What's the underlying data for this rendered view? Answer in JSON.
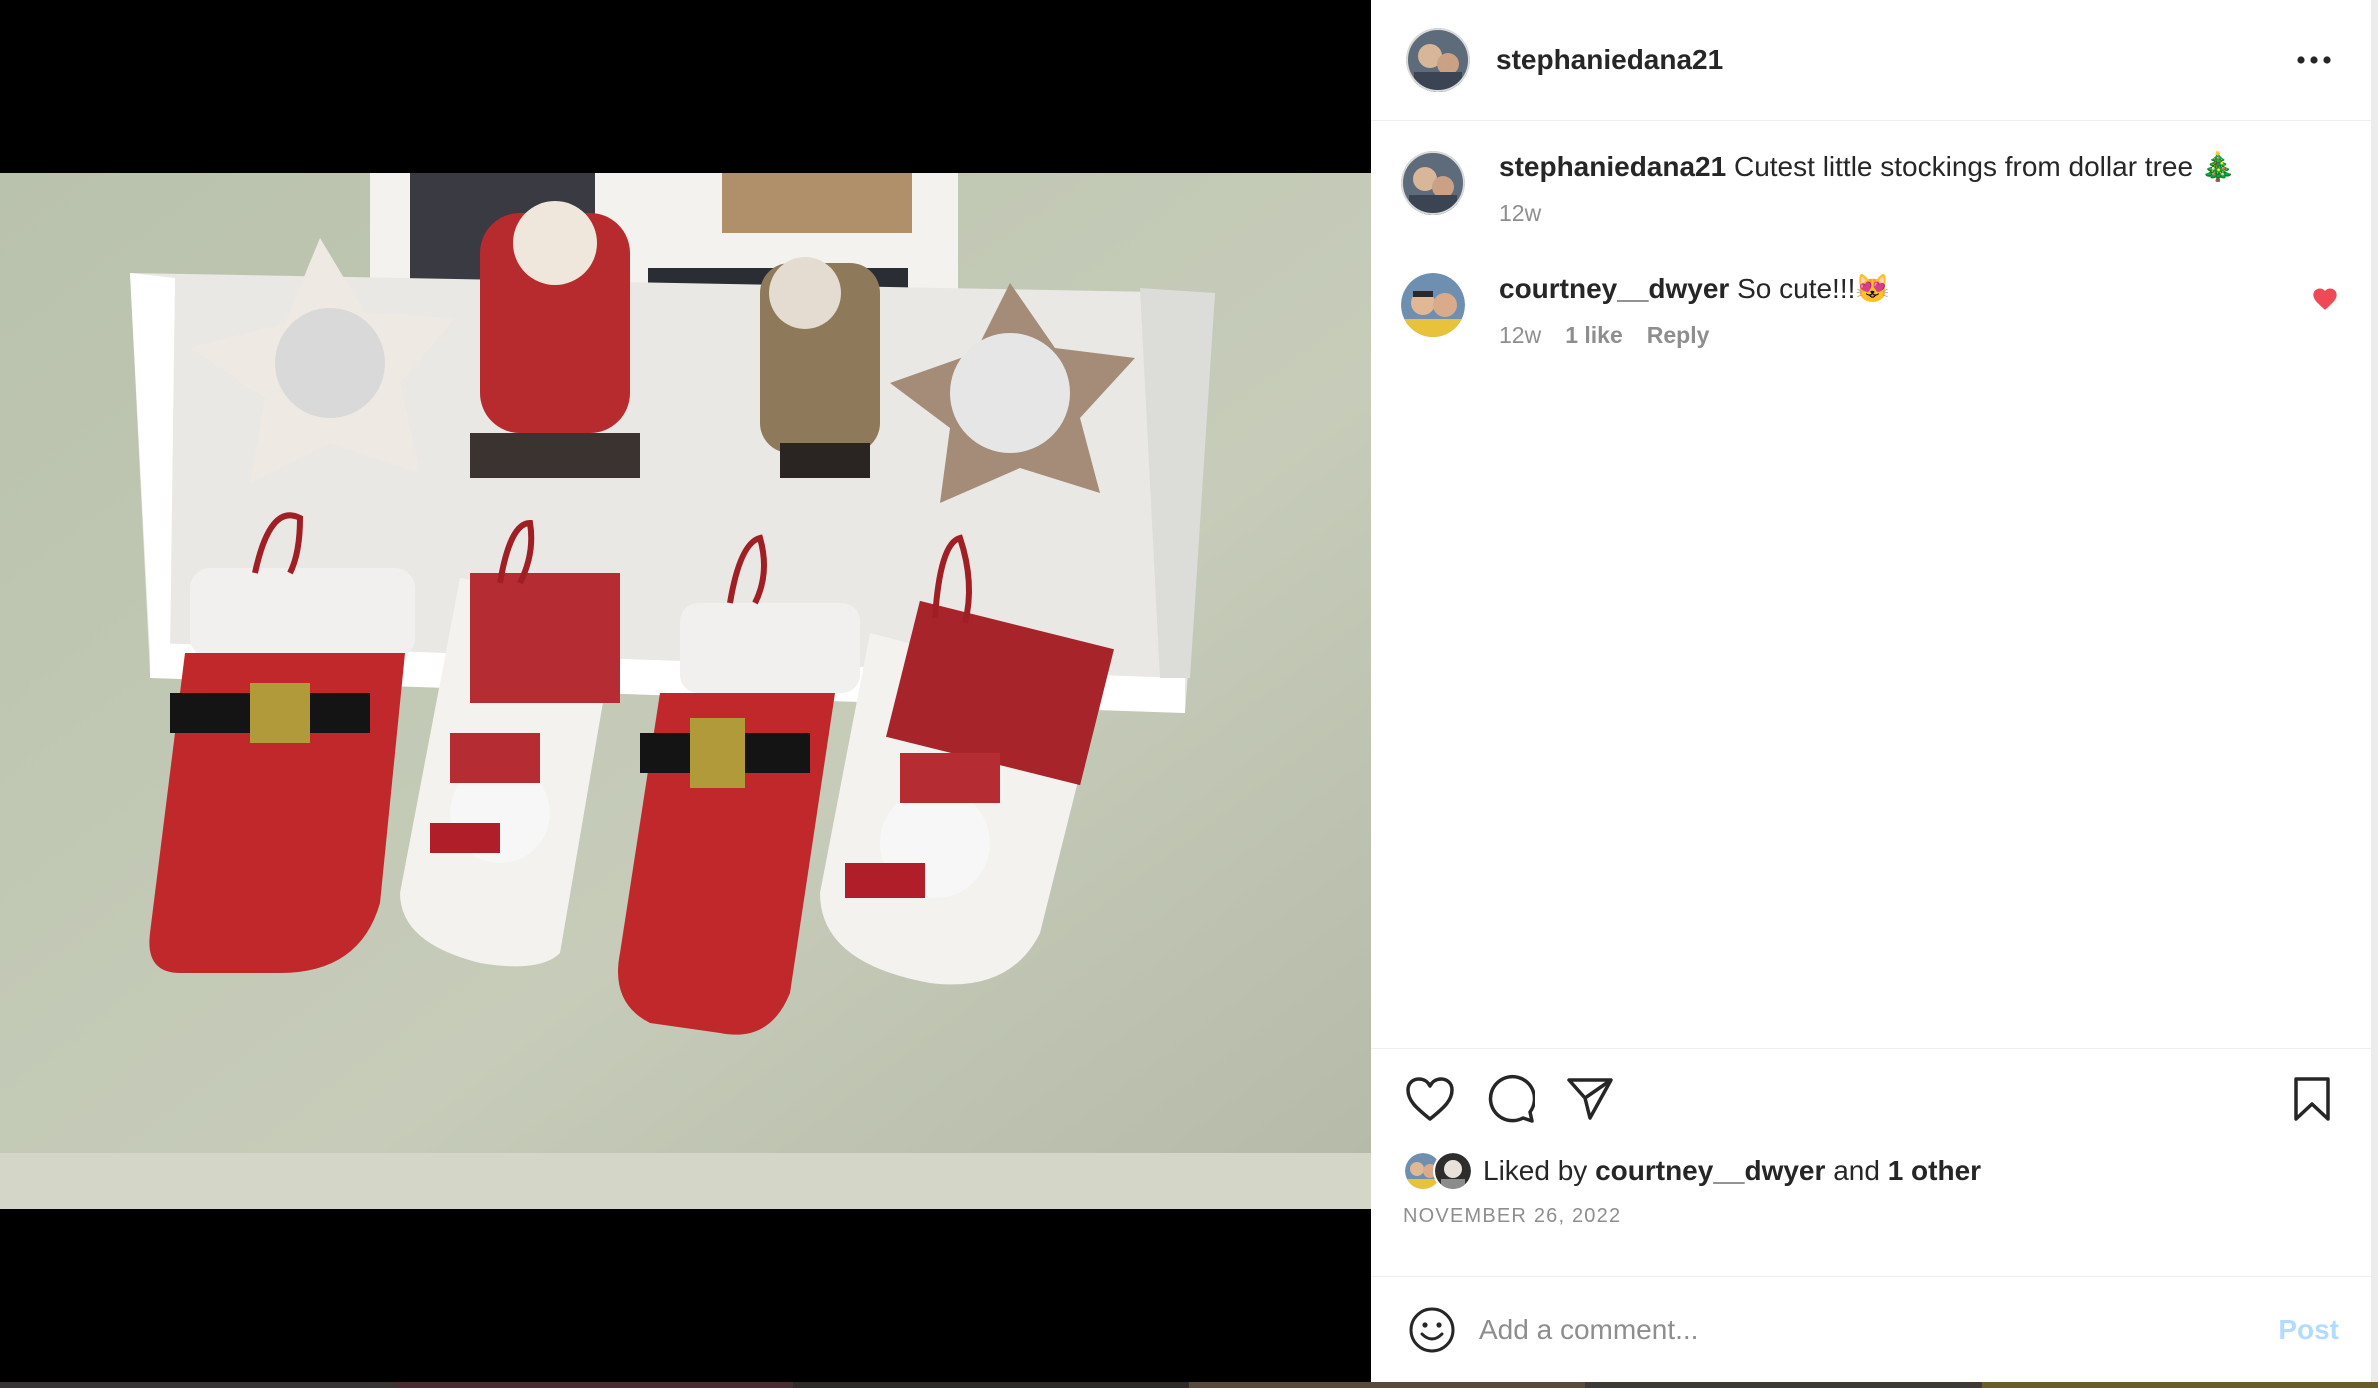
{
  "post": {
    "username": "stephaniedana21",
    "caption_text": "Cutest little stockings from dollar tree 🎄",
    "caption_age": "12w",
    "date": "NOVEMBER 26, 2022"
  },
  "comments": [
    {
      "username": "courtney__dwyer",
      "text": "So cute!!!😻",
      "age": "12w",
      "likes": "1 like",
      "reply": "Reply",
      "liked": true
    }
  ],
  "likes": {
    "prefix": "Liked by",
    "user": "courtney__dwyer",
    "and": "and",
    "others": "1 other"
  },
  "add_comment": {
    "placeholder": "Add a comment...",
    "post_label": "Post"
  },
  "icons": {
    "more": "more-horizontal-icon",
    "like": "heart-icon",
    "comment": "comment-bubble-icon",
    "share": "paper-plane-icon",
    "save": "bookmark-icon",
    "emoji": "emoji-smile-icon",
    "comment_like": "heart-filled-icon"
  },
  "colors": {
    "text": "#262626",
    "muted": "#8e8e8e",
    "heart": "#ed4956",
    "post_disabled": "#b3dbff"
  }
}
